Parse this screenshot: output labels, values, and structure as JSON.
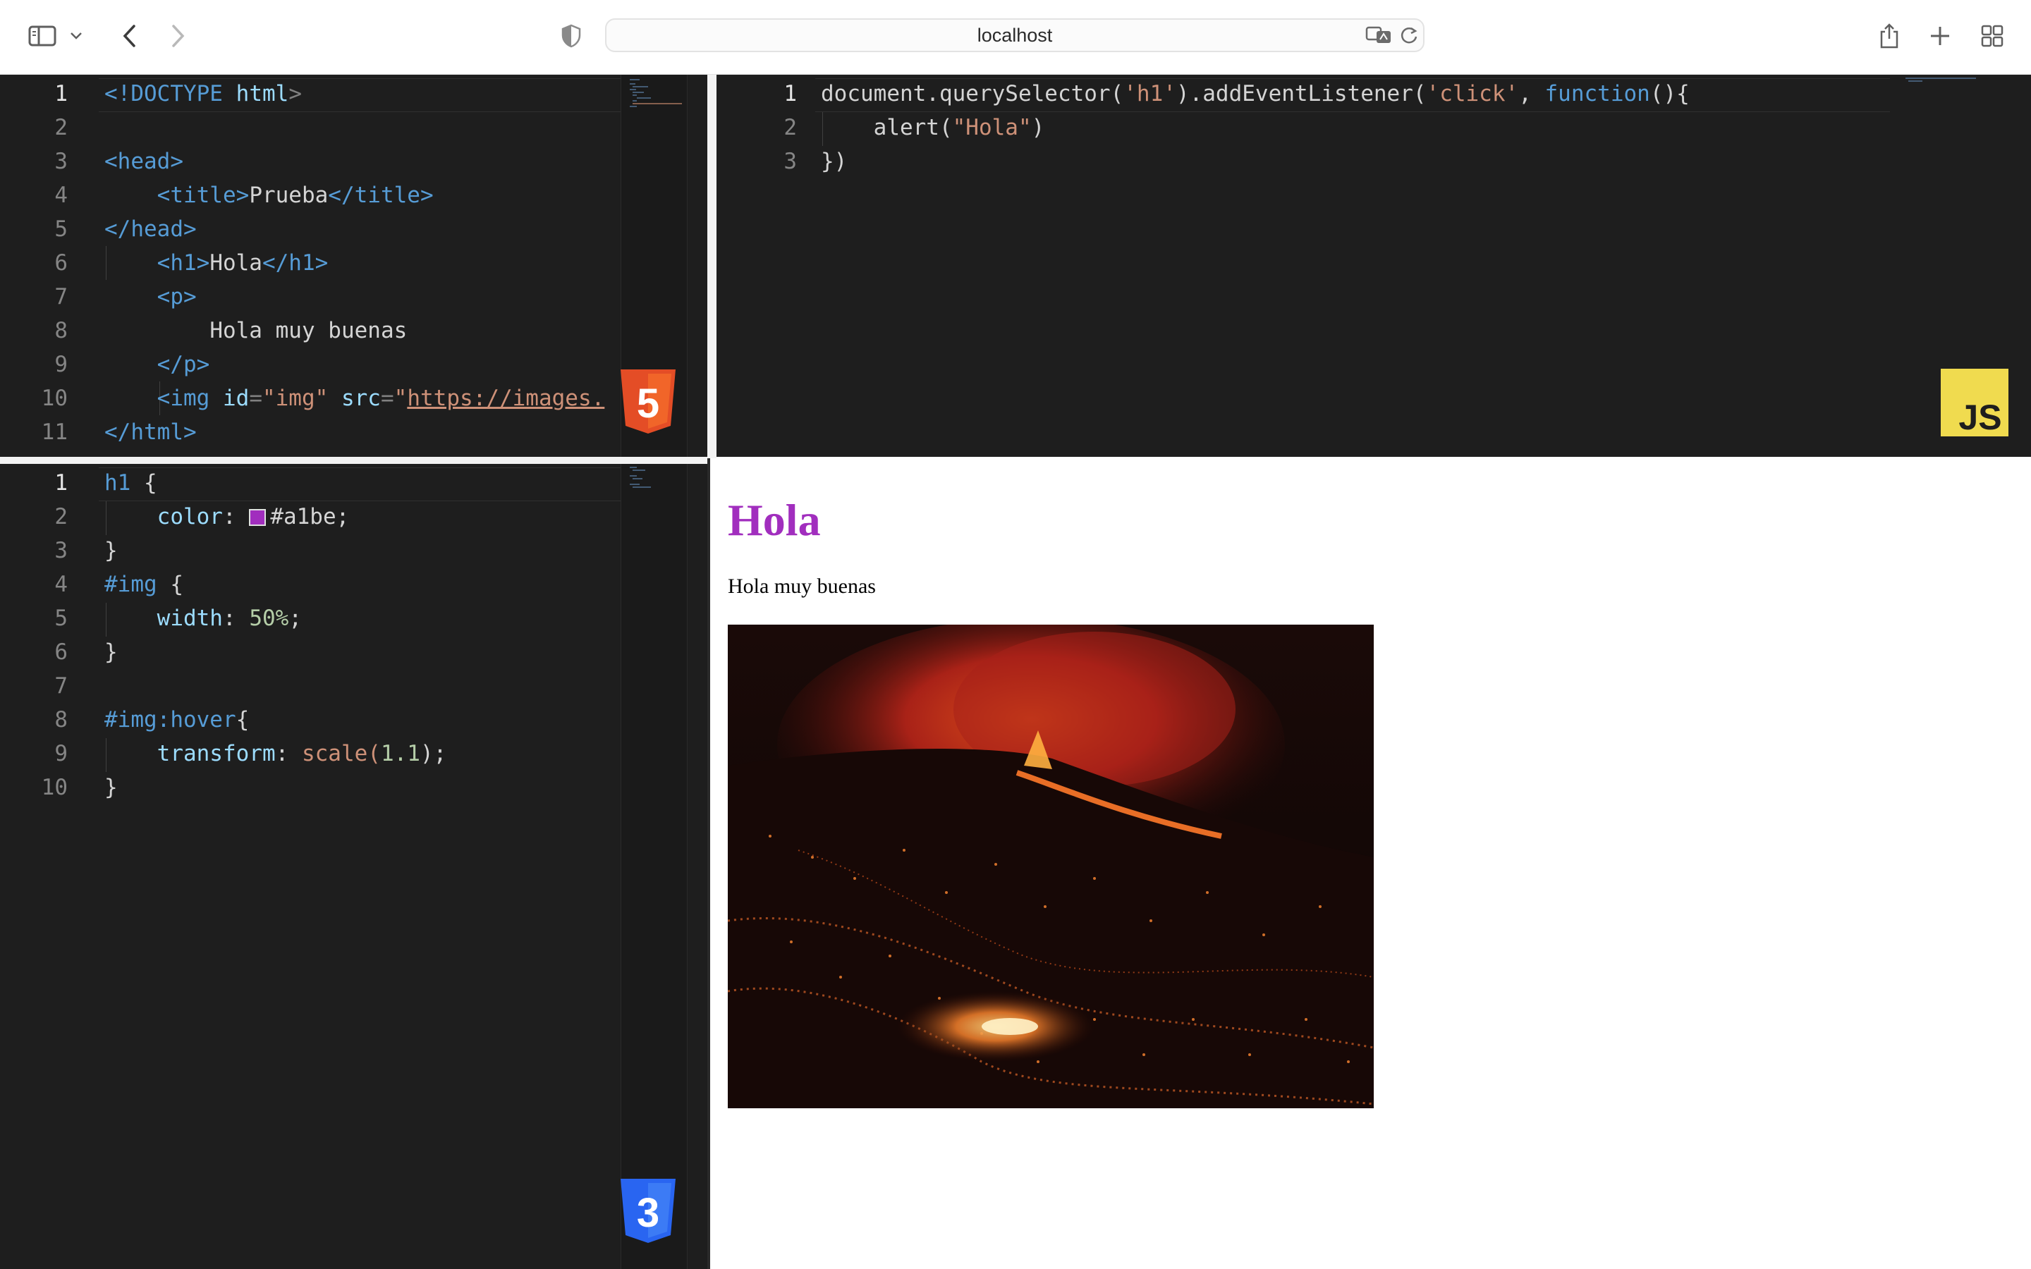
{
  "browser": {
    "url": "localhost"
  },
  "colors": {
    "editor_bg": "#1e1e1e",
    "h1_color": "#a1b1be",
    "heading_preview": "#a12ebe",
    "html_logo": "#e44d26",
    "css_logo": "#2965f1",
    "js_logo": "#f0db4f"
  },
  "icons": [
    "sidebar-icon",
    "chevron-down-icon",
    "back-icon",
    "forward-icon",
    "shield-icon",
    "translate-icon",
    "reload-icon",
    "share-icon",
    "plus-icon",
    "tab-grid-icon",
    "html5-logo",
    "js-logo",
    "css3-logo"
  ],
  "html_editor": {
    "lines": [
      {
        "n": "1"
      },
      {
        "n": "2"
      },
      {
        "n": "3"
      },
      {
        "n": "4"
      },
      {
        "n": "5"
      },
      {
        "n": "6"
      },
      {
        "n": "7"
      },
      {
        "n": "8"
      },
      {
        "n": "9"
      },
      {
        "n": "10"
      },
      {
        "n": "11"
      }
    ],
    "doctype": "<!DOCTYPE",
    "html_kw": "html",
    "gt": ">",
    "head_open": "<head>",
    "title_open": "<title>",
    "title_text": "Prueba",
    "title_close": "</title>",
    "head_close": "</head>",
    "h1_open": "<h1>",
    "h1_text": "Hola",
    "h1_close": "</h1>",
    "p_open": "<p>",
    "p_text": "Hola muy buenas",
    "p_close": "</p>",
    "img_open": "<img",
    "attr_id": "id",
    "eq": "=",
    "id_val": "\"img\"",
    "attr_src": "src",
    "src_q": "\"",
    "src_val": "https://images.",
    "html_close": "</html>",
    "logo_text": "5"
  },
  "js_editor": {
    "lines": [
      {
        "n": "1"
      },
      {
        "n": "2"
      },
      {
        "n": "3"
      }
    ],
    "l1_a": "document.querySelector(",
    "l1_b": "'h1'",
    "l1_c": ").addEventListener(",
    "l1_d": "'click'",
    "l1_e": ", ",
    "l1_f": "function",
    "l1_g": "(){",
    "l2_a": "alert(",
    "l2_b": "\"Hola\"",
    "l2_c": ")",
    "l3": "})",
    "logo_text": "JS"
  },
  "css_editor": {
    "lines": [
      {
        "n": "1"
      },
      {
        "n": "2"
      },
      {
        "n": "3"
      },
      {
        "n": "4"
      },
      {
        "n": "5"
      },
      {
        "n": "6"
      },
      {
        "n": "7"
      },
      {
        "n": "8"
      },
      {
        "n": "9"
      },
      {
        "n": "10"
      }
    ],
    "h1_sel": "h1",
    "open_brace": " {",
    "color_prop": "color",
    "colon": ": ",
    "color_val": "#a1be;",
    "close_brace": "}",
    "img_sel": "#img",
    "width_prop": "width",
    "width_val": "50%",
    "semi": ";",
    "hover_sel": "#img:hover",
    "brace_only": "{",
    "transform_prop": "transform",
    "scale_fn": "scale(",
    "scale_num": "1.1",
    "scale_end": ");",
    "logo_text": "3"
  },
  "preview": {
    "heading": "Hola",
    "paragraph": "Hola muy buenas",
    "image_alt": "volcano eruption at night"
  }
}
